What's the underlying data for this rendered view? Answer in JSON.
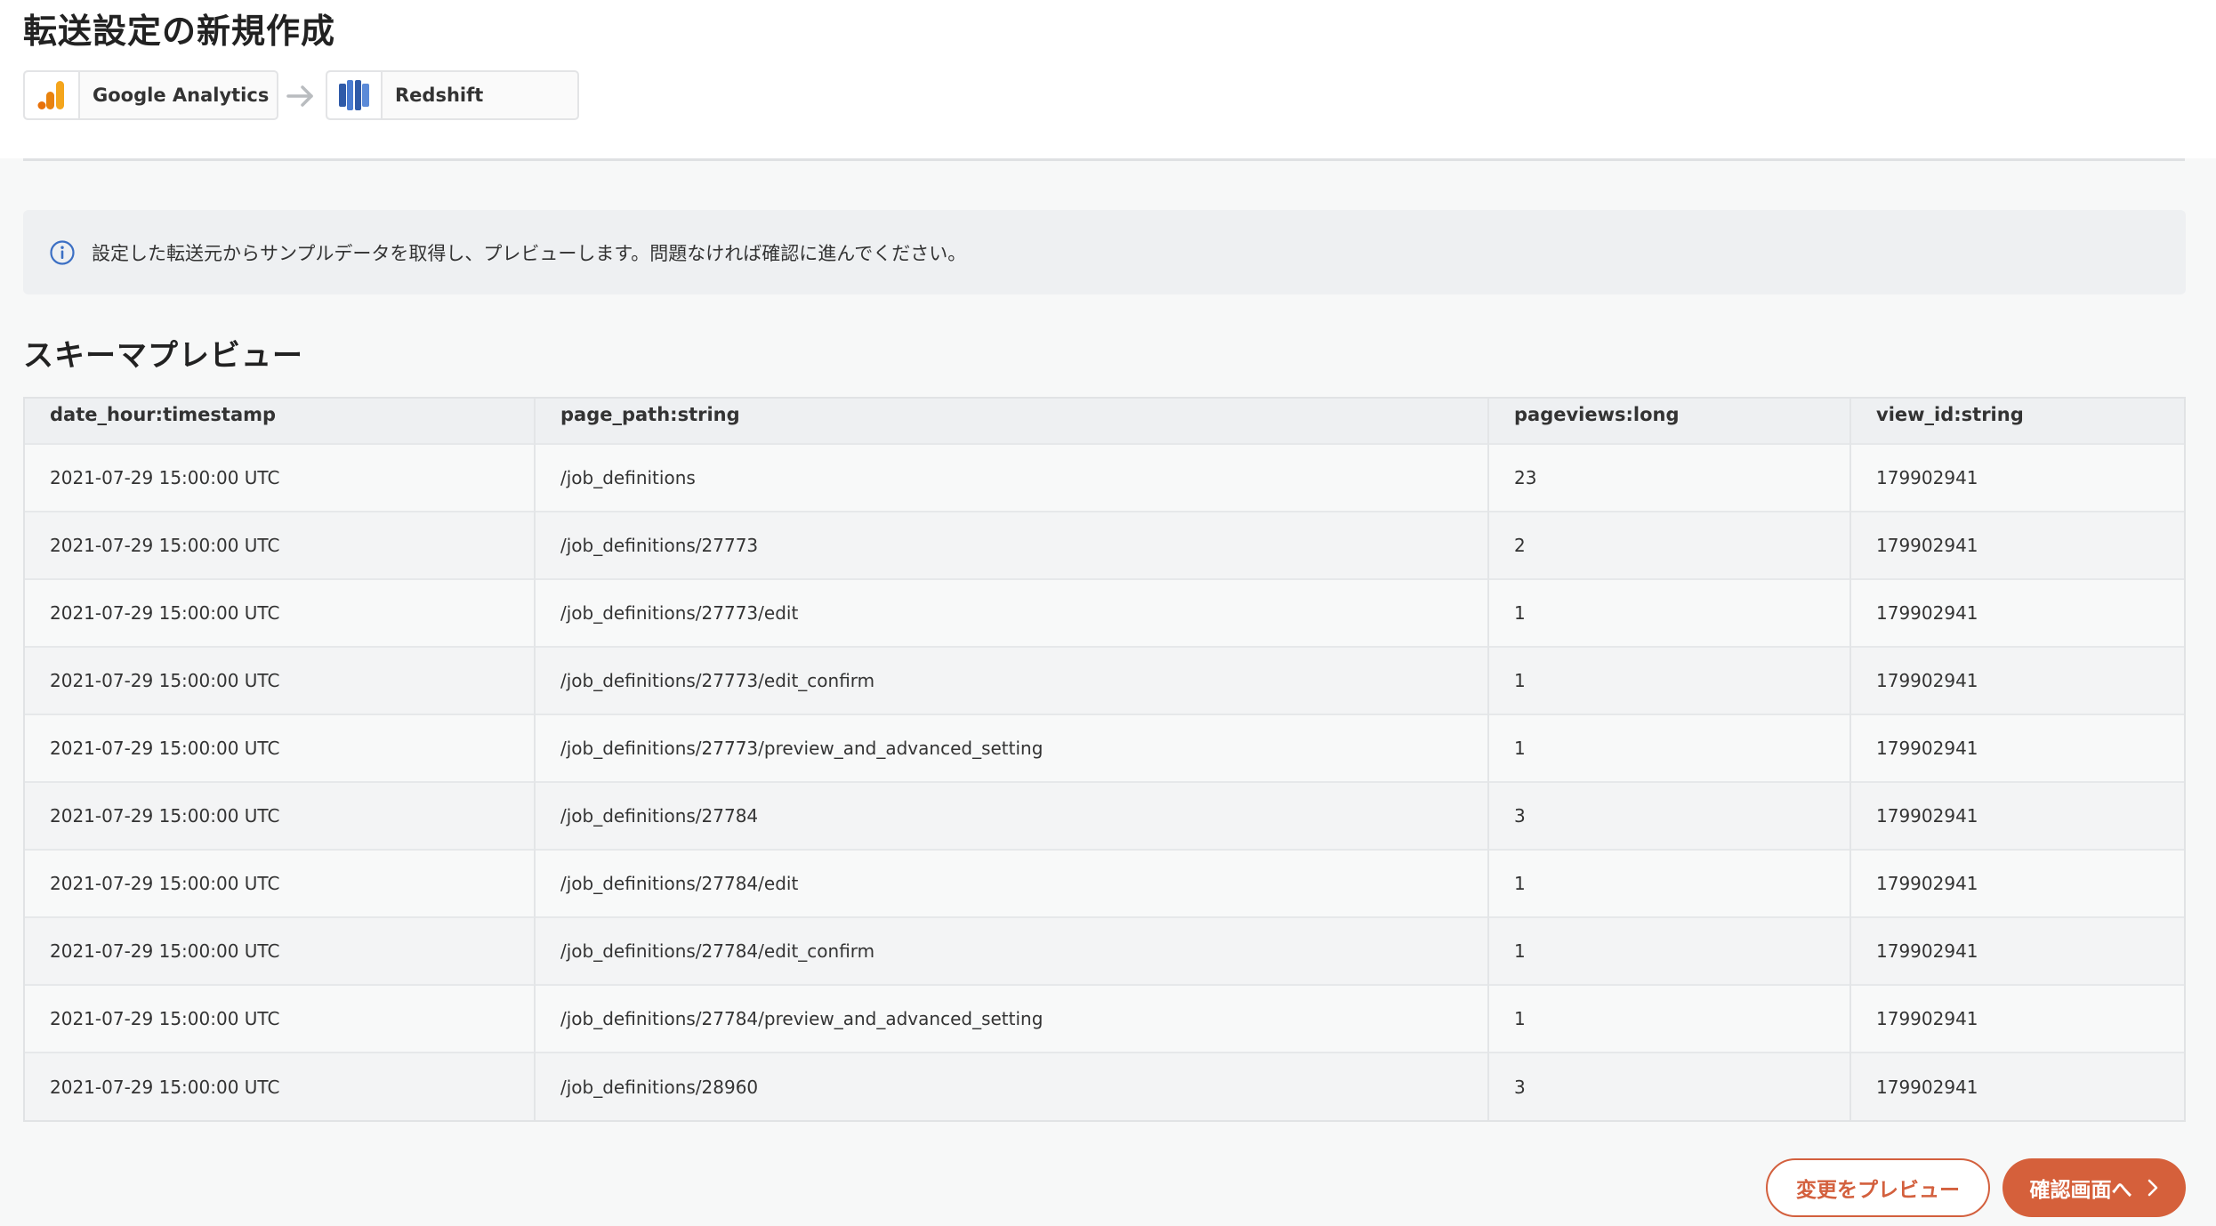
{
  "header": {
    "title": "転送設定の新規作成",
    "source": {
      "label": "Google Analytics",
      "icon": "google-analytics-icon",
      "color": "#f2a21b"
    },
    "destination": {
      "label": "Redshift",
      "icon": "redshift-icon",
      "color": "#2f5aa8"
    }
  },
  "info": {
    "icon": "info-icon",
    "message": "設定した転送元からサンプルデータを取得し、プレビューします。問題なければ確認に進んでください。"
  },
  "schema_preview": {
    "title": "スキーマプレビュー",
    "columns": [
      "date_hour:timestamp",
      "page_path:string",
      "pageviews:long",
      "view_id:string"
    ],
    "rows": [
      [
        "2021-07-29 15:00:00 UTC",
        "/job_definitions",
        "23",
        "179902941"
      ],
      [
        "2021-07-29 15:00:00 UTC",
        "/job_definitions/27773",
        "2",
        "179902941"
      ],
      [
        "2021-07-29 15:00:00 UTC",
        "/job_definitions/27773/edit",
        "1",
        "179902941"
      ],
      [
        "2021-07-29 15:00:00 UTC",
        "/job_definitions/27773/edit_confirm",
        "1",
        "179902941"
      ],
      [
        "2021-07-29 15:00:00 UTC",
        "/job_definitions/27773/preview_and_advanced_setting",
        "1",
        "179902941"
      ],
      [
        "2021-07-29 15:00:00 UTC",
        "/job_definitions/27784",
        "3",
        "179902941"
      ],
      [
        "2021-07-29 15:00:00 UTC",
        "/job_definitions/27784/edit",
        "1",
        "179902941"
      ],
      [
        "2021-07-29 15:00:00 UTC",
        "/job_definitions/27784/edit_confirm",
        "1",
        "179902941"
      ],
      [
        "2021-07-29 15:00:00 UTC",
        "/job_definitions/27784/preview_and_advanced_setting",
        "1",
        "179902941"
      ],
      [
        "2021-07-29 15:00:00 UTC",
        "/job_definitions/28960",
        "3",
        "179902941"
      ]
    ]
  },
  "actions": {
    "preview_label": "変更をプレビュー",
    "confirm_label": "確認画面へ",
    "confirm_icon": "chevron-right-icon",
    "accent_color": "#d5603b"
  }
}
